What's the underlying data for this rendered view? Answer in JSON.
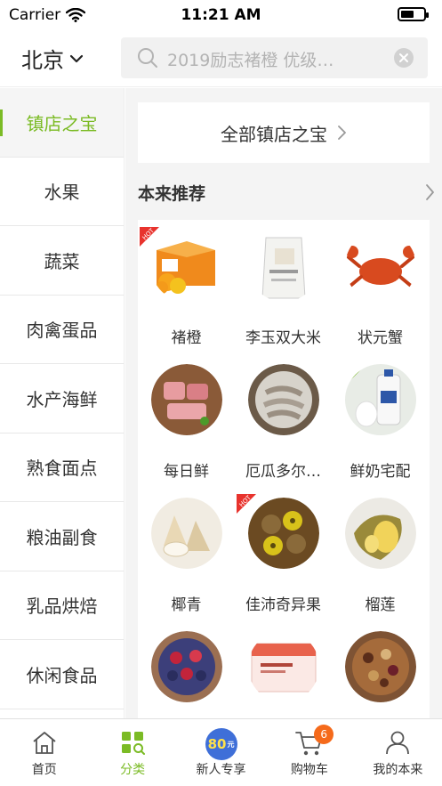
{
  "status": {
    "carrier": "Carrier",
    "time": "11:21 AM",
    "battery_level": 0.6
  },
  "header": {
    "city": "北京",
    "search_placeholder": "2019励志褚橙 优级…"
  },
  "sidebar": {
    "items": [
      {
        "label": "镇店之宝",
        "active": true
      },
      {
        "label": "水果",
        "active": false
      },
      {
        "label": "蔬菜",
        "active": false
      },
      {
        "label": "肉禽蛋品",
        "active": false
      },
      {
        "label": "水产海鲜",
        "active": false
      },
      {
        "label": "熟食面点",
        "active": false
      },
      {
        "label": "粮油副食",
        "active": false
      },
      {
        "label": "乳品烘焙",
        "active": false
      },
      {
        "label": "休闲食品",
        "active": false
      }
    ]
  },
  "main": {
    "all_banner": "全部镇店之宝",
    "recommend_title": "本来推荐",
    "products": [
      {
        "label": "褚橙",
        "hot": true,
        "icon": "orange-box-icon"
      },
      {
        "label": "李玉双大米",
        "hot": false,
        "icon": "rice-bag-icon"
      },
      {
        "label": "状元蟹",
        "hot": false,
        "icon": "crab-icon"
      },
      {
        "label": "每日鲜",
        "hot": false,
        "icon": "pork-icon"
      },
      {
        "label": "厄瓜多尔…",
        "hot": false,
        "icon": "shrimp-icon"
      },
      {
        "label": "鲜奶宅配",
        "hot": false,
        "icon": "milk-icon"
      },
      {
        "label": "椰青",
        "hot": false,
        "icon": "coconut-icon"
      },
      {
        "label": "佳沛奇异果",
        "hot": true,
        "icon": "kiwi-icon"
      },
      {
        "label": "榴莲",
        "hot": false,
        "icon": "durian-icon"
      },
      {
        "label": "",
        "hot": false,
        "icon": "berries-icon"
      },
      {
        "label": "",
        "hot": false,
        "icon": "gift-box-icon"
      },
      {
        "label": "",
        "hot": false,
        "icon": "nuts-icon"
      }
    ]
  },
  "tabbar": {
    "tabs": [
      {
        "label": "首页",
        "icon": "home-icon"
      },
      {
        "label": "分类",
        "icon": "category-icon",
        "active": true
      },
      {
        "label": "新人专享",
        "icon": "coupon-icon",
        "coupon_value": "80",
        "coupon_unit": "元"
      },
      {
        "label": "购物车",
        "icon": "cart-icon",
        "badge": "6"
      },
      {
        "label": "我的本来",
        "icon": "user-icon"
      }
    ]
  },
  "colors": {
    "accent": "#7bbb25",
    "badge": "#f56a1b",
    "hot": "#e8332d"
  }
}
